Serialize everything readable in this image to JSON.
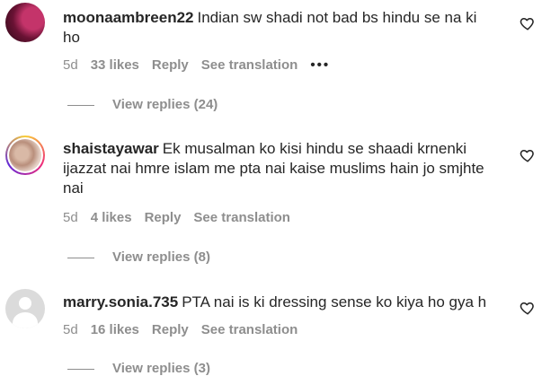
{
  "comments": [
    {
      "username": "moonaambreen22",
      "text": "Indian sw shadi not bad bs hindu se na ki ho",
      "time": "5d",
      "likes": "33 likes",
      "reply": "Reply",
      "translation": "See translation",
      "more": "•••",
      "view_replies": "View replies (24)"
    },
    {
      "username": "shaistayawar",
      "text": "Ek musalman ko kisi hindu se shaadi krnenki ijazzat nai hmre islam me pta nai kaise muslims hain jo smjhte nai",
      "time": "5d",
      "likes": "4 likes",
      "reply": "Reply",
      "translation": "See translation",
      "view_replies": "View replies (8)"
    },
    {
      "username": "marry.sonia.735",
      "text": "PTA nai is ki dressing sense ko kiya ho gya h",
      "time": "5d",
      "likes": "16 likes",
      "reply": "Reply",
      "translation": "See translation",
      "view_replies": "View replies (3)"
    }
  ]
}
